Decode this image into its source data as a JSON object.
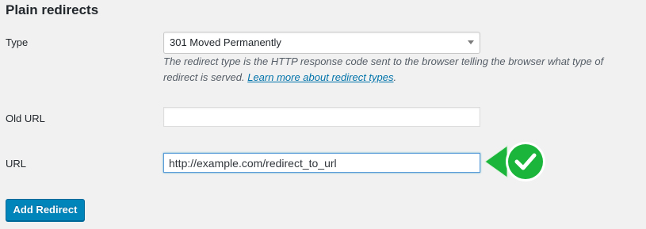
{
  "section": {
    "title": "Plain redirects"
  },
  "type_field": {
    "label": "Type",
    "selected": "301 Moved Permanently",
    "description_prefix": "The redirect type is the HTTP response code sent to the browser telling the browser what type of redirect is served.",
    "description_link": "Learn more about redirect types",
    "description_suffix": "."
  },
  "old_url_field": {
    "label": "Old URL",
    "value": ""
  },
  "url_field": {
    "label": "URL",
    "value": "http://example.com/redirect_to_url"
  },
  "submit": {
    "label": "Add Redirect"
  },
  "colors": {
    "accent": "#0085ba",
    "link": "#0073aa",
    "success": "#1bb53b"
  },
  "icons": {
    "select_arrow": "chevron-down-icon",
    "success_badge": "checkmark-icon"
  }
}
